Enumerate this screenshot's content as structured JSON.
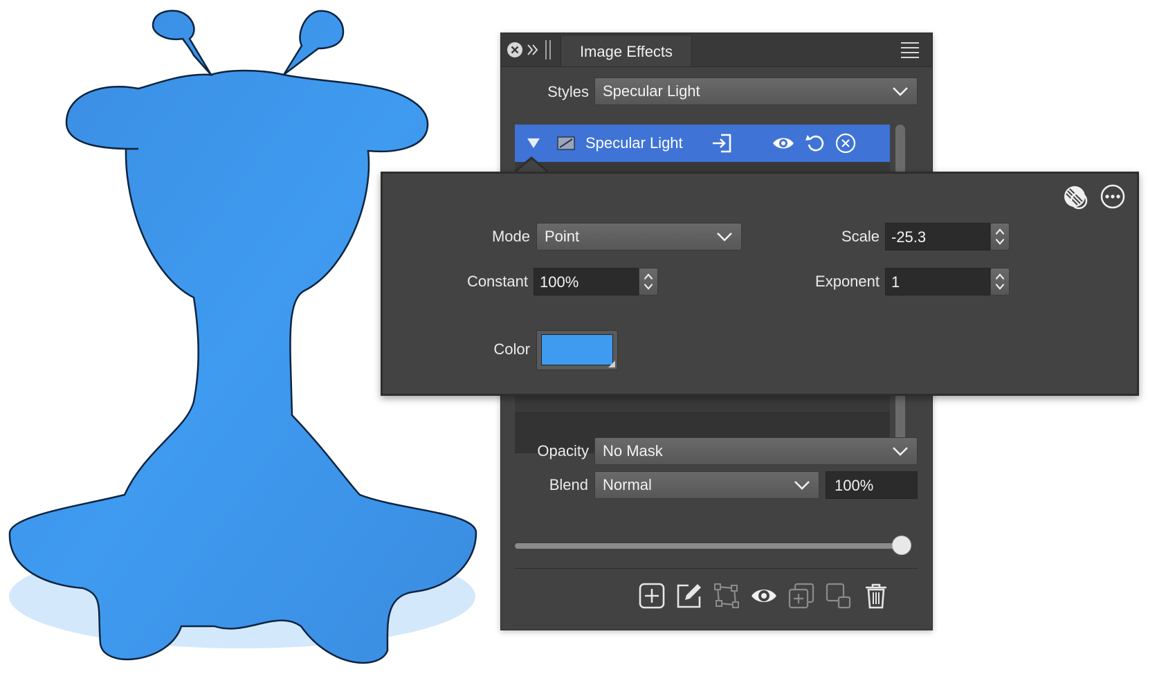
{
  "colors": {
    "figure": "#3f95e6",
    "shadow": "#d3e8fb",
    "selected_row": "#3f73d6",
    "swatch": "#3f9bf0"
  },
  "panel": {
    "tab_title": "Image Effects",
    "icons": {
      "close": "close-circle-icon",
      "collapse": "double-chevron-right-icon",
      "grip": "grip-icon",
      "menu": "hamburger-menu-icon"
    },
    "styles_label": "Styles",
    "styles_value": "Specular Light",
    "effect": {
      "name": "Specular Light",
      "icons": [
        "disclosure-triangle-icon",
        "effect-thumbnail-icon",
        "import-icon",
        "visibility-eye-icon",
        "reset-icon",
        "remove-icon"
      ]
    },
    "opacity_label": "Opacity",
    "opacity_value": "No Mask",
    "blend_label": "Blend",
    "blend_value": "Normal",
    "blend_percent": "100%",
    "slider_fraction": 1.0,
    "bottom_icons": [
      "add-icon",
      "edit-icon",
      "transform-icon",
      "visibility-icon",
      "duplicate-icon",
      "copy-icon",
      "trash-icon"
    ]
  },
  "popover": {
    "mode_label": "Mode",
    "mode_value": "Point",
    "constant_label": "Constant",
    "constant_value": "100%",
    "scale_label": "Scale",
    "scale_value": "-25.3",
    "exponent_label": "Exponent",
    "exponent_value": "1",
    "color_label": "Color",
    "icons": [
      "mask-icon",
      "more-options-icon"
    ]
  }
}
